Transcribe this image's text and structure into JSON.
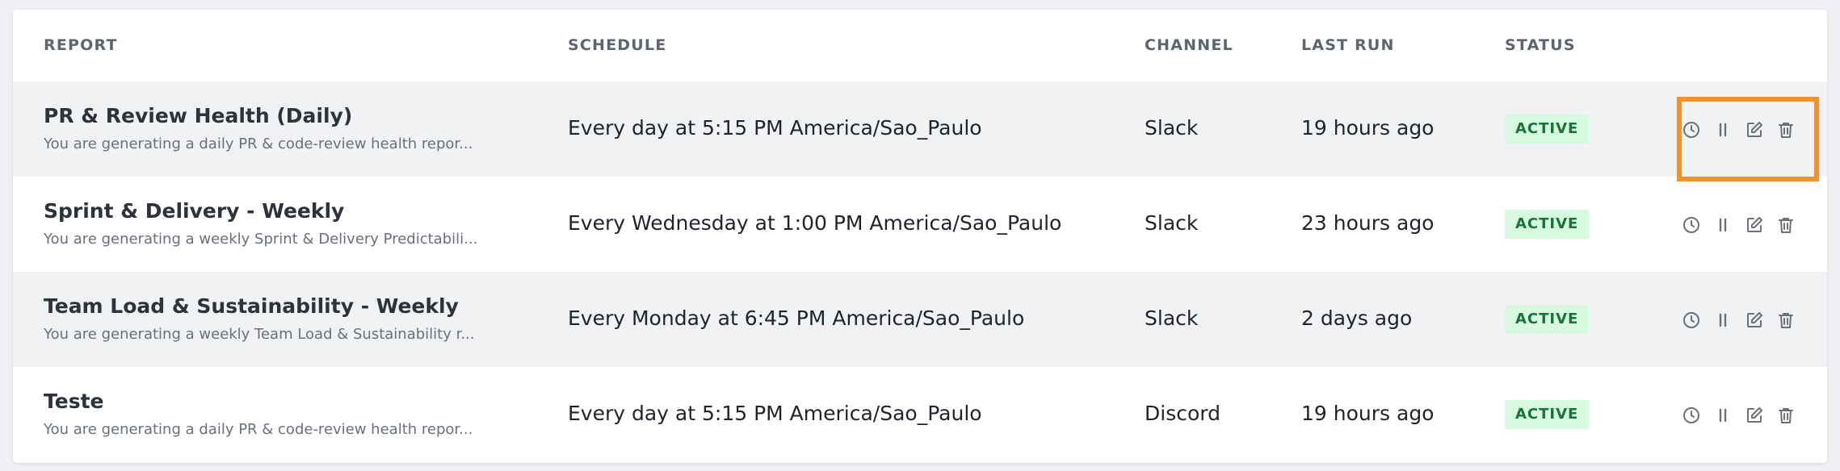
{
  "table": {
    "headers": {
      "report": "REPORT",
      "schedule": "SCHEDULE",
      "channel": "CHANNEL",
      "last_run": "LAST RUN",
      "status": "STATUS"
    },
    "rows": [
      {
        "title": "PR & Review Health (Daily)",
        "description": "You are generating a daily PR & code-review health repor...",
        "schedule": "Every day at 5:15 PM America/Sao_Paulo",
        "channel": "Slack",
        "last_run": "19 hours ago",
        "status": "ACTIVE"
      },
      {
        "title": "Sprint & Delivery - Weekly",
        "description": "You are generating a weekly Sprint & Delivery Predictabili...",
        "schedule": "Every Wednesday at 1:00 PM America/Sao_Paulo",
        "channel": "Slack",
        "last_run": "23 hours ago",
        "status": "ACTIVE"
      },
      {
        "title": "Team Load & Sustainability - Weekly",
        "description": "You are generating a weekly Team Load & Sustainability r...",
        "schedule": "Every Monday at 6:45 PM America/Sao_Paulo",
        "channel": "Slack",
        "last_run": "2 days ago",
        "status": "ACTIVE"
      },
      {
        "title": "Teste",
        "description": "You are generating a daily PR & code-review health repor...",
        "schedule": "Every day at 5:15 PM America/Sao_Paulo",
        "channel": "Discord",
        "last_run": "19 hours ago",
        "status": "ACTIVE"
      }
    ],
    "action_icons": [
      "clock-icon",
      "pause-icon",
      "edit-icon",
      "trash-icon"
    ]
  },
  "colors": {
    "highlight": "#f0922e",
    "badge_bg": "#d7f9df",
    "badge_text": "#17733a",
    "alt_row": "#f1f2f4"
  }
}
